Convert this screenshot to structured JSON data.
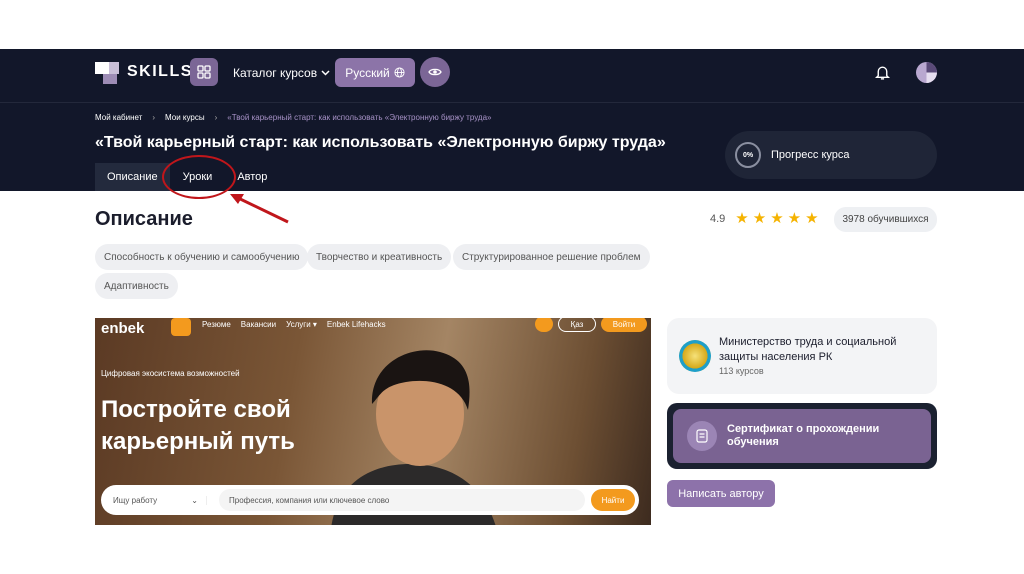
{
  "nav": {
    "logo_text": "SKILLS",
    "catalog_label": "Каталог курсов",
    "language_label": "Русский"
  },
  "breadcrumb": {
    "items": [
      "Мой кабинет",
      "Мои курсы",
      "«Твой карьерный старт: как использовать «Электронную биржу труда»"
    ]
  },
  "course": {
    "title": "«Твой карьерный старт: как использовать «Электронную биржу труда»",
    "progress_percent": "0%",
    "progress_label": "Прогресс курса"
  },
  "tabs": [
    {
      "label": "Описание",
      "active": true
    },
    {
      "label": "Уроки",
      "active": false
    },
    {
      "label": "Автор",
      "active": false
    }
  ],
  "description": {
    "heading": "Описание",
    "rating": "4.9",
    "stars": 5,
    "learners": "3978 обучившихся",
    "skills": [
      "Способность к обучению и самообучению",
      "Творчество и креативность",
      "Структурированное решение проблем",
      "Адаптивность"
    ]
  },
  "banner": {
    "logo": "enbek",
    "menu": [
      "Резюме",
      "Вакансии",
      "Услуги ▾",
      "Enbek Lifehacks"
    ],
    "lang": "Қаз",
    "login": "Войти",
    "eco": "Цифровая экосистема возможностей",
    "headline": "Постройте свой карьерный путь",
    "search_select": "Ищу работу",
    "search_placeholder": "Профессия, компания или ключевое слово",
    "search_button": "Найти"
  },
  "author": {
    "name": "Министерство труда и социальной защиты населения РК",
    "courses": "113 курсов"
  },
  "certificate": {
    "label": "Сертификат о прохождении обучения"
  },
  "write_author_label": "Написать автору",
  "colors": {
    "header_bg": "#12172a",
    "accent_purple": "#8c74a8",
    "annotation_red": "#c0161b",
    "star": "#f5b301",
    "enbek_orange": "#f39a1e"
  }
}
